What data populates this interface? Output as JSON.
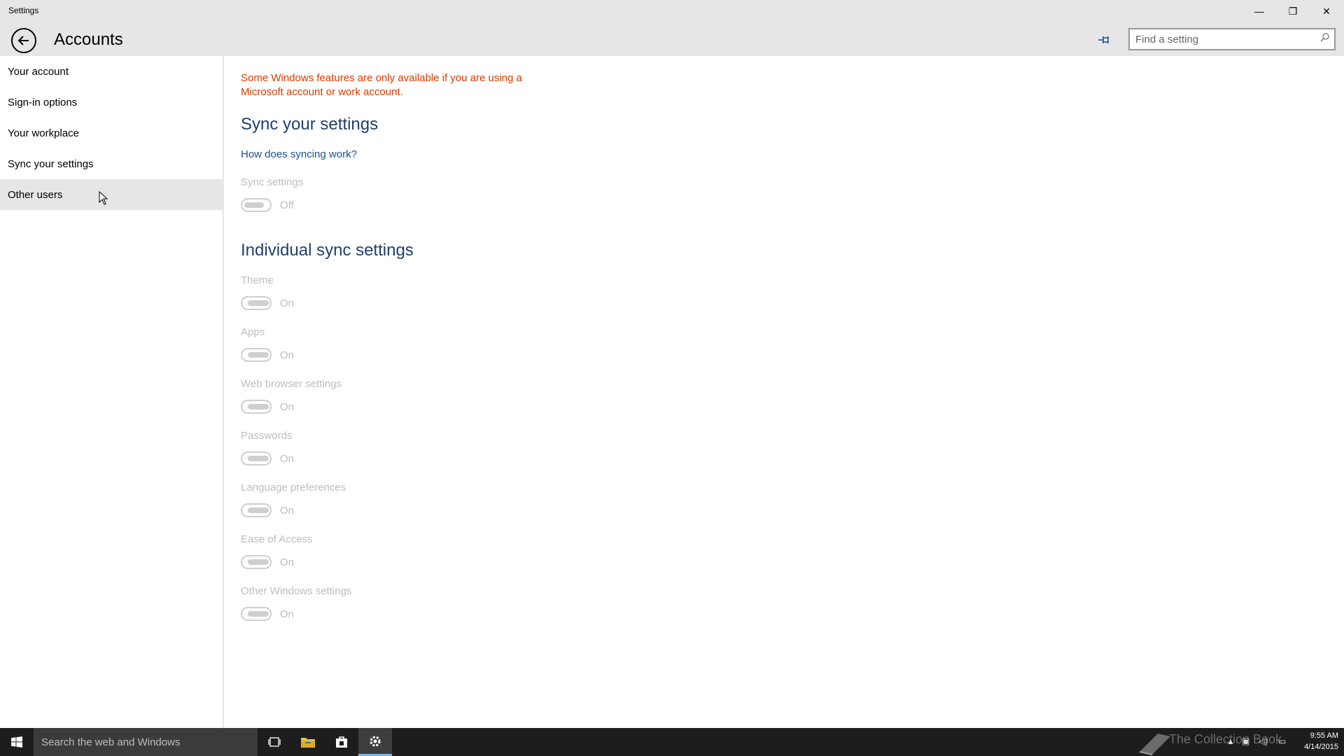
{
  "window": {
    "title": "Settings",
    "minimize_glyph": "—",
    "maximize_glyph": "❐",
    "close_glyph": "✕"
  },
  "header": {
    "page_title": "Accounts",
    "search_placeholder": "Find a setting"
  },
  "sidebar": {
    "items": [
      {
        "label": "Your account"
      },
      {
        "label": "Sign-in options"
      },
      {
        "label": "Your workplace"
      },
      {
        "label": "Sync your settings"
      },
      {
        "label": "Other users"
      }
    ]
  },
  "main": {
    "warning": "Some Windows features are only available if you are using a Microsoft account or work account.",
    "sync_heading": "Sync your settings",
    "sync_link": "How does syncing work?",
    "sync_settings": {
      "label": "Sync settings",
      "state": "Off"
    },
    "individual_heading": "Individual sync settings",
    "individual": [
      {
        "label": "Theme",
        "state": "On"
      },
      {
        "label": "Apps",
        "state": "On"
      },
      {
        "label": "Web browser settings",
        "state": "On"
      },
      {
        "label": "Passwords",
        "state": "On"
      },
      {
        "label": "Language preferences",
        "state": "On"
      },
      {
        "label": "Ease of Access",
        "state": "On"
      },
      {
        "label": "Other Windows settings",
        "state": "On"
      }
    ]
  },
  "taskbar": {
    "search_placeholder": "Search the web and Windows",
    "watermark": "The Collection Book",
    "time": "9:55 AM",
    "date": "4/14/2015"
  },
  "colors": {
    "warning": "#d23c00",
    "heading": "#1f3f6b",
    "link": "#1a4f8a",
    "disabled_text": "#bdbdbd",
    "chrome": "#e6e6e6",
    "taskbar": "#1d1d1d"
  }
}
